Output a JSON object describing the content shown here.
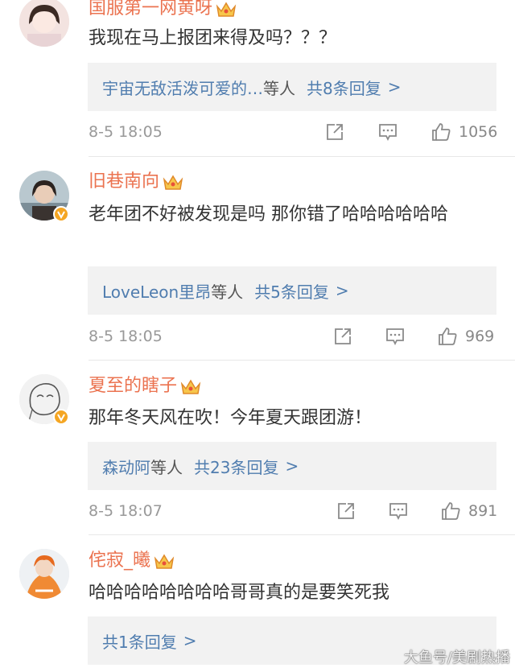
{
  "comments": [
    {
      "username": "国服第一网黄呀",
      "text": "我现在马上报团来得及吗？？？",
      "reply_names": "宇宙无敌活泼可爱的…",
      "reply_mid": "等人",
      "reply_count": "共8条回复",
      "reply_arrow": ">",
      "time": "8-5 18:05",
      "likes": "1056"
    },
    {
      "username": "旧巷南向",
      "text": "老年团不好被发现是吗 那你错了哈哈哈哈哈哈",
      "reply_names": "LoveLeon里昂",
      "reply_mid": "等人",
      "reply_count": "共5条回复",
      "reply_arrow": ">",
      "time": "8-5 18:05",
      "likes": "969"
    },
    {
      "username": "夏至的瞎子",
      "text": "那年冬天风在吹！今年夏天跟团游！",
      "reply_names": "森动阿",
      "reply_mid": "等人",
      "reply_count": "共23条回复",
      "reply_arrow": ">",
      "time": "8-5 18:07",
      "likes": "891"
    },
    {
      "username": "侘寂_曦",
      "text": "哈哈哈哈哈哈哈哈哥哥真的是要笑死我",
      "reply_count": "共1条回复",
      "reply_arrow": ">"
    }
  ],
  "watermark": "大鱼号/美剧热播",
  "icons": [
    "crown-icon",
    "verified-icon",
    "share-icon",
    "comment-icon",
    "like-icon"
  ],
  "colors": {
    "username": "#eb7350",
    "link": "#507daf",
    "reply_bg": "#f2f2f2",
    "meta": "#999999",
    "verified": "#f5a623"
  }
}
